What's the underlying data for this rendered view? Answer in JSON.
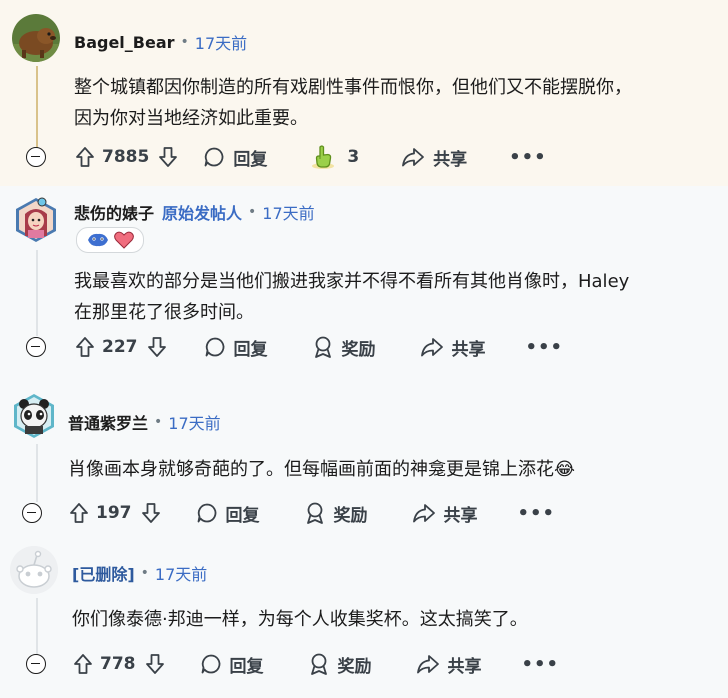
{
  "comments": [
    {
      "author": "Bagel_Bear",
      "dot": "•",
      "time": "17天前",
      "body_line1": "整个城镇都因你制造的所有戏剧性事件而恨你，但他们又不能摆脱你，",
      "body_line2": "因为你对当地经济如此重要。",
      "votes": "7885",
      "reply_label": "回复",
      "award_count": "3",
      "share_label": "共享",
      "more_label": "•••"
    },
    {
      "author": "悲伤的婊子",
      "op_badge": "原始发帖人",
      "dot": "•",
      "time": "17天前",
      "body_line1": "我最喜欢的部分是当他们搬进我家并不得不看所有其他肖像时，Haley",
      "body_line2": "在那里花了很多时间。",
      "votes": "227",
      "reply_label": "回复",
      "award_label": "奖励",
      "share_label": "共享",
      "more_label": "•••"
    },
    {
      "author": "普通紫罗兰",
      "dot": "•",
      "time": "17天前",
      "body_line1": "肖像画本身就够奇葩的了。但每幅画前面的神龛更是锦上添花😂",
      "votes": "197",
      "reply_label": "回复",
      "award_label": "奖励",
      "share_label": "共享",
      "more_label": "•••"
    },
    {
      "author": "[已删除]",
      "dot": "•",
      "time": "17天前",
      "body_line1": "你们像泰德·邦迪一样，为每个人收集奖杯。这太搞笑了。",
      "votes": "778",
      "reply_label": "回复",
      "award_label": "奖励",
      "share_label": "共享",
      "more_label": "•••"
    }
  ],
  "icons": {
    "upvote": "upvote-arrow-icon",
    "downvote": "downvote-arrow-icon",
    "reply": "speech-bubble-icon",
    "award": "award-ribbon-icon",
    "share": "share-arrow-icon",
    "collapse": "collapse-minus-icon",
    "gold_award": "pointing-hand-award-icon"
  },
  "colors": {
    "highlight_bg": "#fbf7ef",
    "page_bg": "#f7f9fa",
    "link_blue": "#3b6cc4",
    "op_blue": "#3b6cc4",
    "thread_gold": "#d9c28a"
  }
}
